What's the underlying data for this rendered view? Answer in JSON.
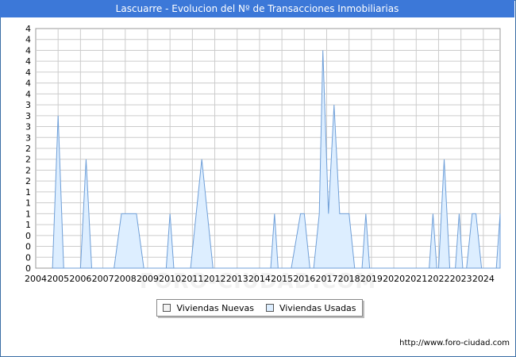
{
  "title": "Lascuarre - Evolucion del Nº de Transacciones Inmobiliarias",
  "source": "http://www.foro-ciudad.com",
  "watermark": "FORO-CIUDAD.COM",
  "colors": {
    "title_bg": "#3c78d8",
    "nuevas_fill": "#f2f2f2",
    "usadas_fill": "#ddeeff",
    "usadas_stroke": "#6f9fd8",
    "grid": "#cccccc"
  },
  "chart_data": {
    "type": "area",
    "title": "Lascuarre - Evolucion del Nº de Transacciones Inmobiliarias",
    "xlabel": "",
    "ylabel": "",
    "xlim": [
      2004,
      2024.75
    ],
    "ylim": [
      0,
      4.4
    ],
    "y_tick_labels": [
      "0",
      "0",
      "0",
      "0",
      "1",
      "1",
      "1",
      "1",
      "2",
      "2",
      "2",
      "2",
      "3",
      "3",
      "3",
      "3",
      "4",
      "4",
      "4",
      "4",
      "4",
      "4",
      "4"
    ],
    "x_tick_labels": [
      "2004",
      "2005",
      "2006",
      "2007",
      "2008",
      "2009",
      "2010",
      "2011",
      "2012",
      "2013",
      "2014",
      "2015",
      "2016",
      "2017",
      "2018",
      "2019",
      "2020",
      "2021",
      "2022",
      "2023",
      "2024"
    ],
    "grid": true,
    "legend_position": "bottom",
    "series": [
      {
        "name": "Viviendas Nuevas",
        "points": []
      },
      {
        "name": "Viviendas Usadas",
        "points": [
          [
            2004.75,
            0
          ],
          [
            2005.0,
            2.8
          ],
          [
            2005.25,
            0
          ],
          [
            2006.0,
            0
          ],
          [
            2006.25,
            2.0
          ],
          [
            2006.5,
            0
          ],
          [
            2007.5,
            0
          ],
          [
            2007.83,
            1.0
          ],
          [
            2008.5,
            1.0
          ],
          [
            2008.83,
            0
          ],
          [
            2009.83,
            0
          ],
          [
            2010.0,
            1.0
          ],
          [
            2010.17,
            0
          ],
          [
            2010.92,
            0
          ],
          [
            2011.42,
            2.0
          ],
          [
            2011.92,
            0
          ],
          [
            2014.5,
            0
          ],
          [
            2014.67,
            1.0
          ],
          [
            2014.83,
            0
          ],
          [
            2015.42,
            0
          ],
          [
            2015.83,
            1.0
          ],
          [
            2016.0,
            1.0
          ],
          [
            2016.25,
            0
          ],
          [
            2016.42,
            0
          ],
          [
            2016.67,
            1.0
          ],
          [
            2016.83,
            4.0
          ],
          [
            2017.08,
            1.0
          ],
          [
            2017.33,
            3.0
          ],
          [
            2017.58,
            1.0
          ],
          [
            2018.0,
            1.0
          ],
          [
            2018.25,
            0
          ],
          [
            2018.58,
            0
          ],
          [
            2018.75,
            1.0
          ],
          [
            2018.92,
            0
          ],
          [
            2021.58,
            0
          ],
          [
            2021.75,
            1.0
          ],
          [
            2021.92,
            0
          ],
          [
            2022.0,
            0
          ],
          [
            2022.25,
            2.0
          ],
          [
            2022.5,
            0
          ],
          [
            2022.75,
            0
          ],
          [
            2022.92,
            1.0
          ],
          [
            2023.08,
            0
          ],
          [
            2023.25,
            0
          ],
          [
            2023.5,
            1.0
          ],
          [
            2023.67,
            1.0
          ],
          [
            2023.92,
            0
          ],
          [
            2024.58,
            0
          ],
          [
            2024.75,
            1.0
          ]
        ]
      }
    ]
  },
  "legend": {
    "items": [
      "Viviendas Nuevas",
      "Viviendas Usadas"
    ]
  }
}
